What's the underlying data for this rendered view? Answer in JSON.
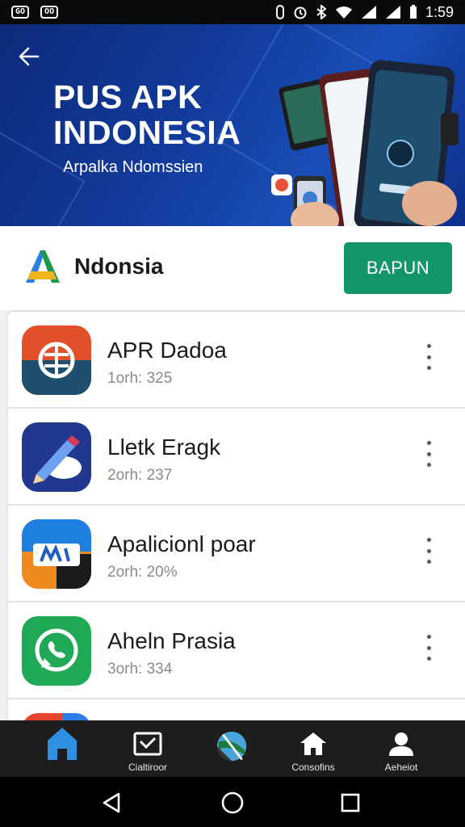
{
  "status_bar": {
    "left_badges": [
      "GO",
      "OO"
    ],
    "time": "1:59"
  },
  "banner": {
    "title_line1": "PUS APK",
    "title_line2": "INDONESIA",
    "subtitle": "Arpalka Ndomssien"
  },
  "header": {
    "brand_name": "Ndonsia",
    "cta_label": "BAPUN"
  },
  "apps": [
    {
      "name": "APR Dadoa",
      "meta": "1orh: 325",
      "icon": "globe-app-icon"
    },
    {
      "name": "Lletk Eragk",
      "meta": "2orh: 237",
      "icon": "pencil-cloud-app-icon"
    },
    {
      "name": "Apalicionl poar",
      "meta": "2orh: 20%",
      "icon": "m-logo-app-icon"
    },
    {
      "name": "Aheln Prasia",
      "meta": "3orh: 334",
      "icon": "whatsapp-icon"
    }
  ],
  "bottom_nav": {
    "items": [
      {
        "label": "",
        "icon": "home-icon"
      },
      {
        "label": "Cialtiroor",
        "icon": "message-icon"
      },
      {
        "label": "",
        "icon": "globe-icon"
      },
      {
        "label": "Consofins",
        "icon": "house-icon"
      },
      {
        "label": "Aeheiot",
        "icon": "person-icon"
      }
    ]
  },
  "colors": {
    "accent": "#13946b",
    "banner": "#123a9a",
    "nav_active": "#2f8fe0"
  }
}
